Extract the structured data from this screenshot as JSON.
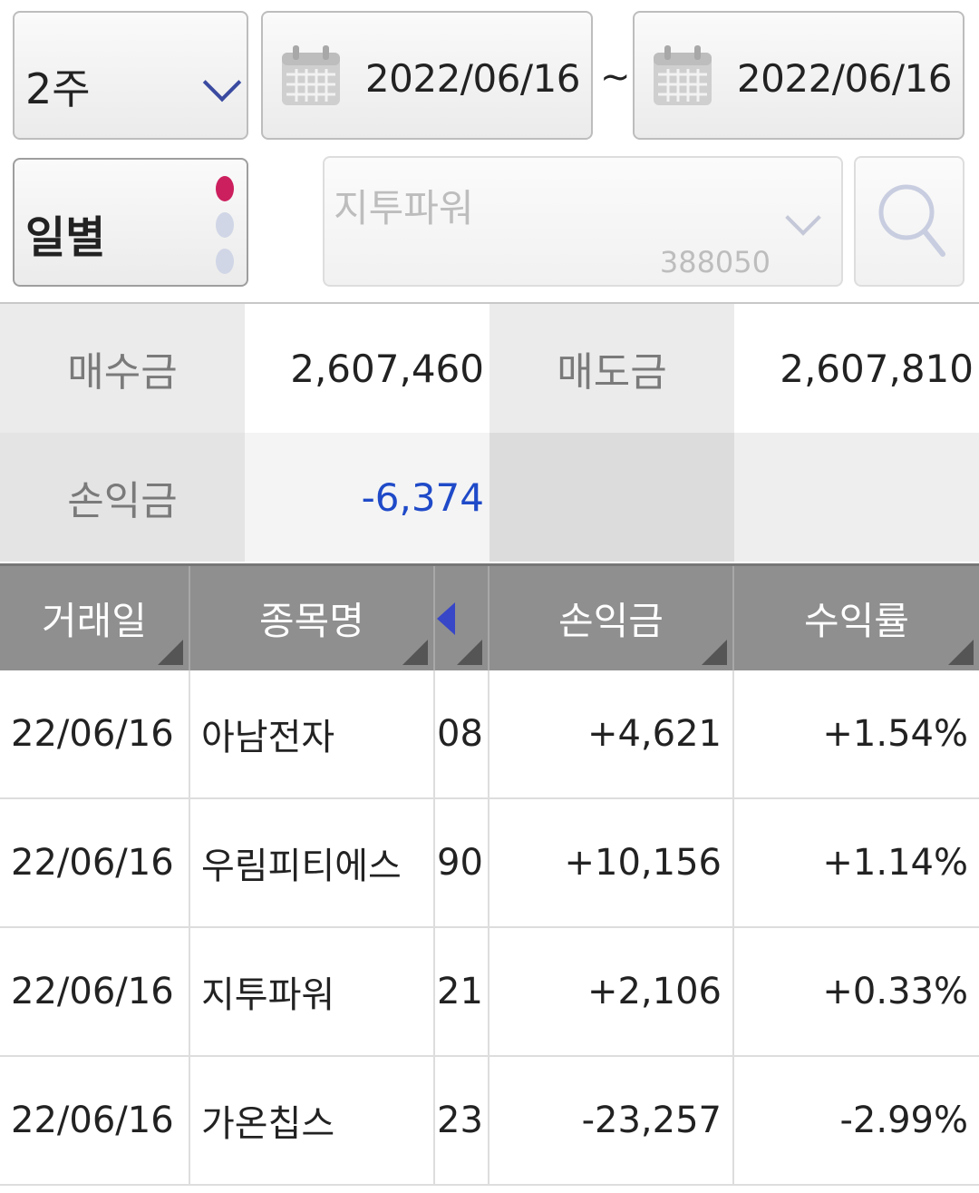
{
  "filters": {
    "period": "2주",
    "date_from": "2022/06/16",
    "date_separator": "~",
    "date_to": "2022/06/16",
    "mode": "일별",
    "stock_name": "지투파워",
    "stock_code": "388050"
  },
  "summary": {
    "buy_label": "매수금",
    "buy_value": "2,607,460",
    "sell_label": "매도금",
    "sell_value": "2,607,810",
    "pl_label": "손익금",
    "pl_value": "-6,374"
  },
  "table": {
    "headers": {
      "date": "거래일",
      "name": "종목명",
      "pl": "손익금",
      "rate": "수익률"
    },
    "rows": [
      {
        "date": "22/06/16",
        "name": "아남전자",
        "code": "08",
        "pl": "+4,621",
        "rate": "+1.54%",
        "sign": "pos"
      },
      {
        "date": "22/06/16",
        "name": "우림피티에스",
        "code": "90",
        "pl": "+10,156",
        "rate": "+1.14%",
        "sign": "pos"
      },
      {
        "date": "22/06/16",
        "name": "지투파워",
        "code": "21",
        "pl": "+2,106",
        "rate": "+0.33%",
        "sign": "pos"
      },
      {
        "date": "22/06/16",
        "name": "가온칩스",
        "code": "23",
        "pl": "-23,257",
        "rate": "-2.99%",
        "sign": "neg"
      }
    ]
  },
  "colors": {
    "positive": "#d8246a",
    "negative": "#1f4ac8",
    "header_bg": "#8f8f8f",
    "accent": "#cc1f5e"
  }
}
